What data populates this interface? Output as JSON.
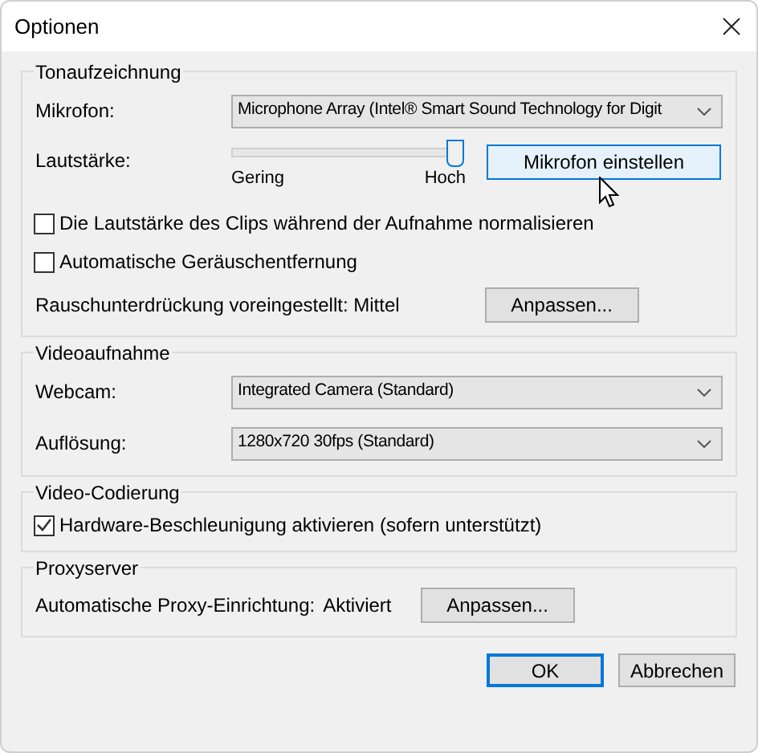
{
  "window": {
    "title": "Optionen"
  },
  "groups": [
    {
      "title": "Tonaufzeichnung",
      "rows": [
        {
          "kind": "select",
          "label": "Mikrofon:",
          "value": "Microphone Array (Intel® Smart Sound Technology for Digit"
        },
        {
          "kind": "slider",
          "label": "Lautstärke:",
          "level": 1,
          "min_label": "Gering",
          "max_label": "Hoch",
          "button": {
            "label": "Mikrofon einstellen",
            "hovered": true
          }
        },
        {
          "kind": "checkbox",
          "label": "Die Lautstärke des Clips während der Aufnahme normalisieren",
          "checked": false
        },
        {
          "kind": "checkbox",
          "label": "Automatische Geräuschentfernung",
          "checked": false
        },
        {
          "kind": "setting",
          "label": "Rauschunterdrückung voreingestellt: Mittel",
          "button": {
            "label": "Anpassen...",
            "hovered": false
          }
        }
      ]
    },
    {
      "title": "Videoaufnahme",
      "rows": [
        {
          "kind": "select",
          "label": "Webcam:",
          "value": "Integrated Camera (Standard)"
        },
        {
          "kind": "select",
          "label": "Auflösung:",
          "value": "1280x720 30fps (Standard)"
        }
      ]
    },
    {
      "title": "Video-Codierung",
      "rows": [
        {
          "kind": "checkbox",
          "label": "Hardware-Beschleunigung aktivieren (sofern unterstützt)",
          "checked": true
        }
      ]
    },
    {
      "title": "Proxyserver",
      "rows": [
        {
          "kind": "setting",
          "label": "Automatische Proxy-Einrichtung:",
          "value": "Aktiviert",
          "button": {
            "label": "Anpassen...",
            "hovered": false
          }
        }
      ]
    }
  ],
  "buttons": [
    {
      "label": "OK",
      "default": true
    },
    {
      "label": "Abbrechen",
      "default": false
    }
  ]
}
